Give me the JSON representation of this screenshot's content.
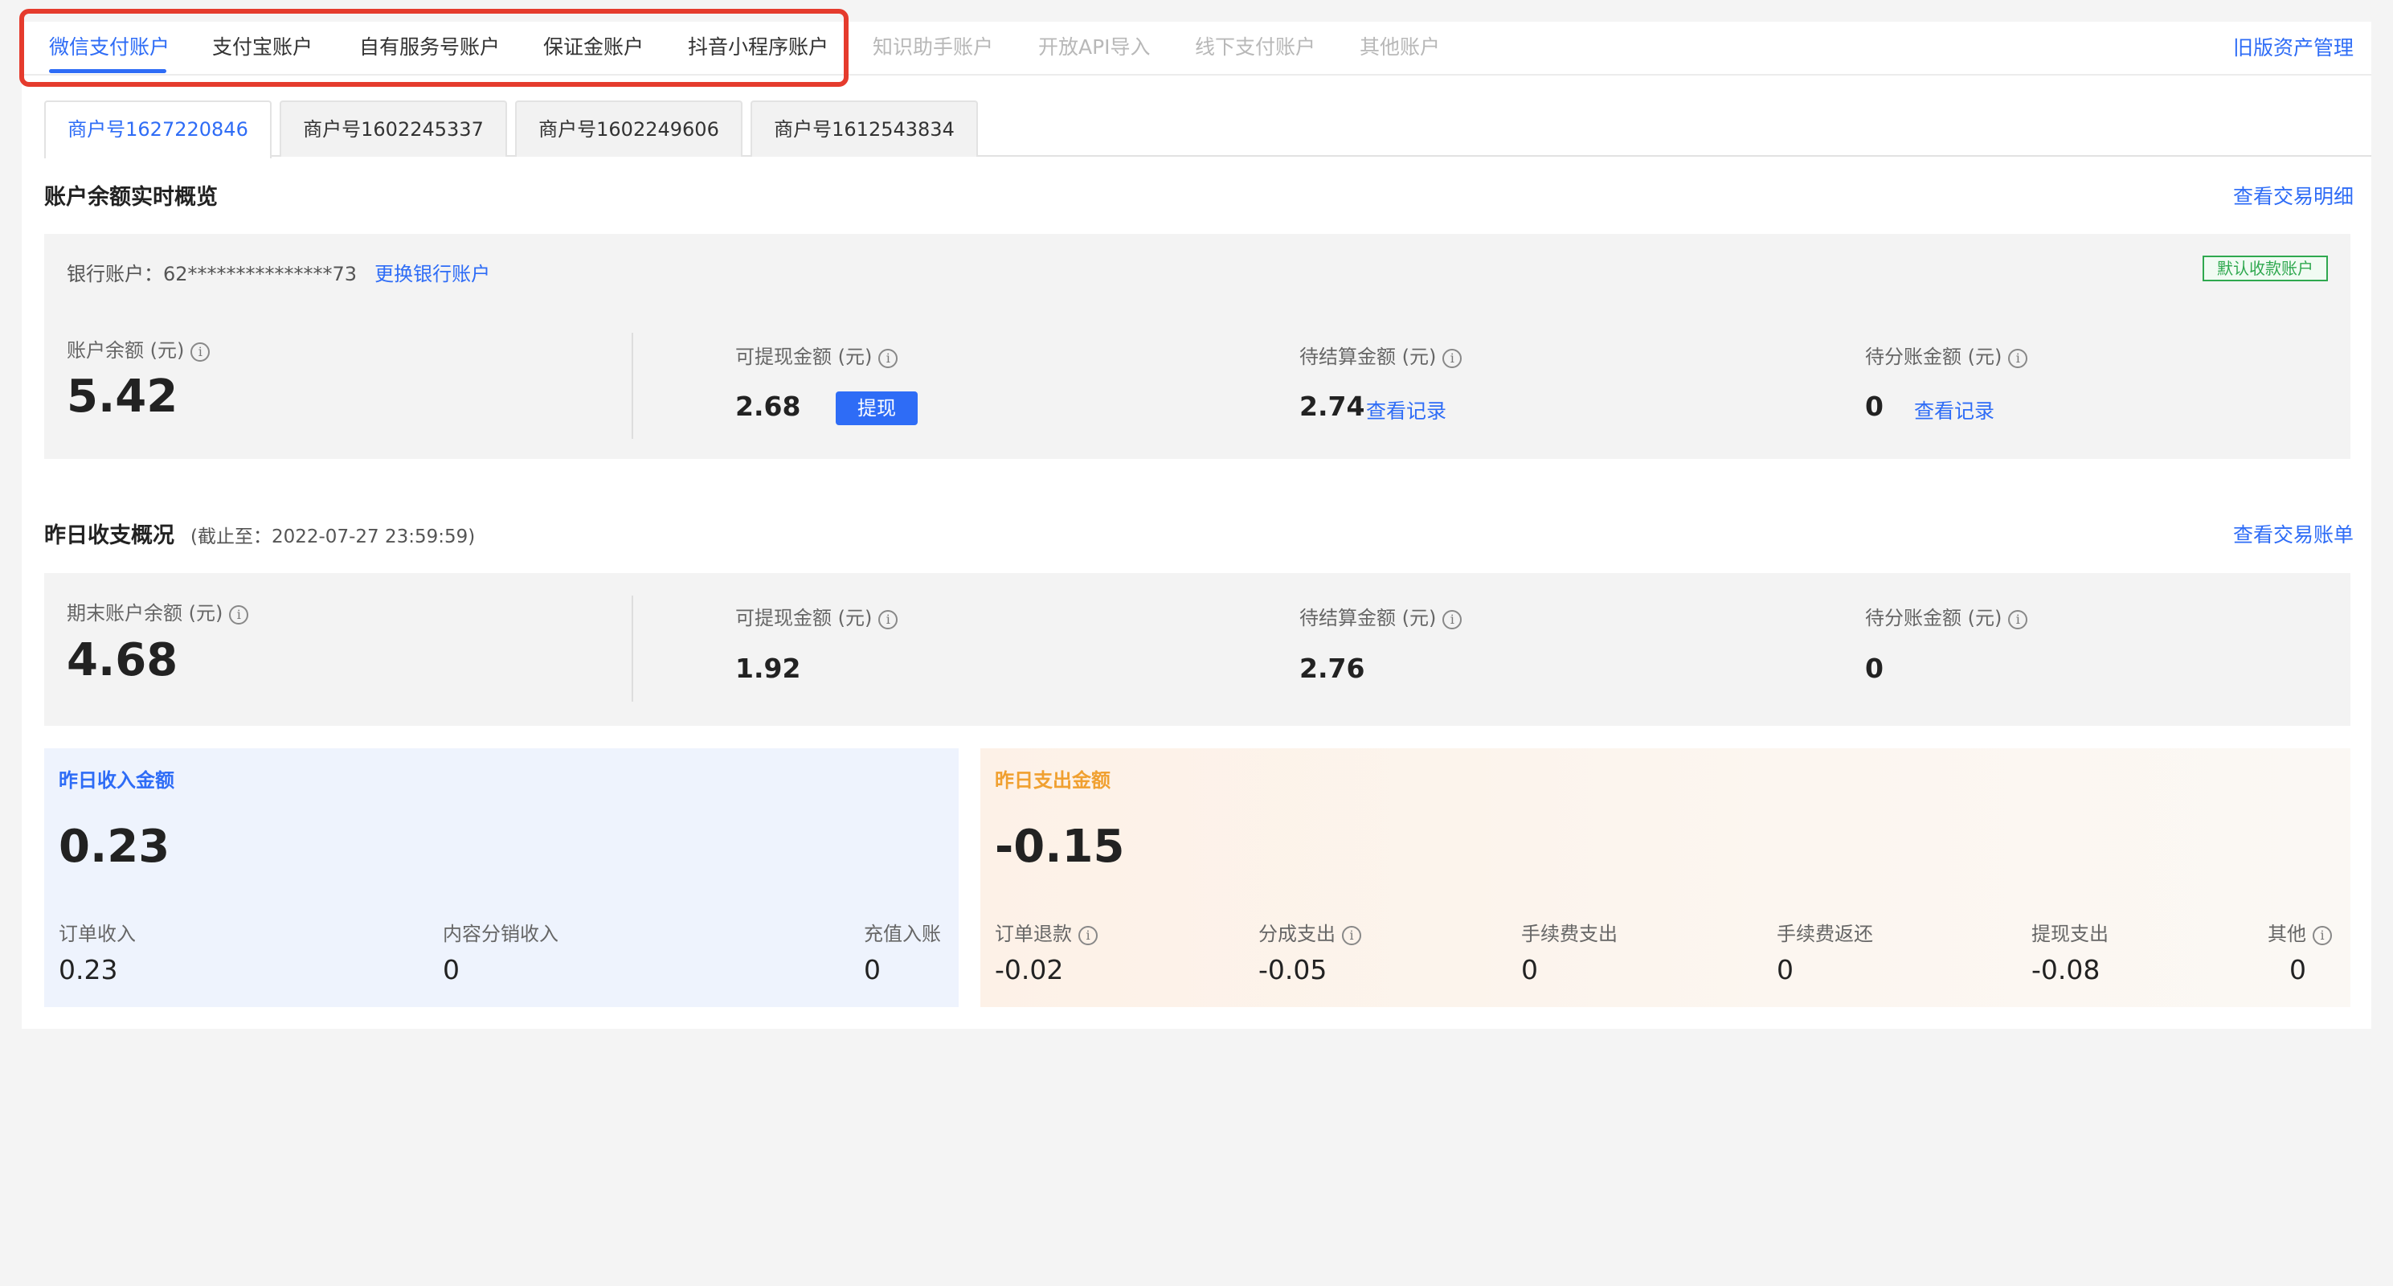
{
  "tabs": {
    "items": [
      {
        "label": "微信支付账户",
        "state": "active"
      },
      {
        "label": "支付宝账户",
        "state": "normal"
      },
      {
        "label": "自有服务号账户",
        "state": "normal"
      },
      {
        "label": "保证金账户",
        "state": "normal"
      },
      {
        "label": "抖音小程序账户",
        "state": "normal"
      },
      {
        "label": "知识助手账户",
        "state": "disabled"
      },
      {
        "label": "开放API导入",
        "state": "disabled"
      },
      {
        "label": "线下支付账户",
        "state": "disabled"
      },
      {
        "label": "其他账户",
        "state": "disabled"
      }
    ],
    "right_link": "旧版资产管理"
  },
  "merchant_tabs": [
    "商户号1627220846",
    "商户号1602245337",
    "商户号1602249606",
    "商户号1612543834"
  ],
  "balance_overview": {
    "title": "账户余额实时概览",
    "link": "查看交易明细",
    "bank_label": "银行账户：",
    "bank_number": "62***************73",
    "change_bank": "更换银行账户",
    "badge": "默认收款账户",
    "account_balance_label": "账户余额 (元)",
    "account_balance": "5.42",
    "withdrawable_label": "可提现金额 (元)",
    "withdrawable": "2.68",
    "withdraw_button": "提现",
    "pending_settle_label": "待结算金额 (元)",
    "pending_settle": "2.74",
    "pending_settle_link": "查看记录",
    "pending_split_label": "待分账金额 (元)",
    "pending_split": "0",
    "pending_split_link": "查看记录"
  },
  "yesterday": {
    "title": "昨日收支概况",
    "subtitle": "(截止至：2022-07-27 23:59:59)",
    "link": "查看交易账单",
    "end_balance_label": "期末账户余额 (元)",
    "end_balance": "4.68",
    "withdrawable_label": "可提现金额 (元)",
    "withdrawable": "1.92",
    "pending_settle_label": "待结算金额 (元)",
    "pending_settle": "2.76",
    "pending_split_label": "待分账金额 (元)",
    "pending_split": "0"
  },
  "income": {
    "title": "昨日收入金额",
    "total": "0.23",
    "items": [
      {
        "label": "订单收入",
        "value": "0.23"
      },
      {
        "label": "内容分销收入",
        "value": "0"
      },
      {
        "label": "充值入账",
        "value": "0"
      }
    ]
  },
  "expense": {
    "title": "昨日支出金额",
    "total": "-0.15",
    "items": [
      {
        "label": "订单退款",
        "value": "-0.02"
      },
      {
        "label": "分成支出",
        "value": "-0.05"
      },
      {
        "label": "手续费支出",
        "value": "0"
      },
      {
        "label": "手续费返还",
        "value": "0"
      },
      {
        "label": "提现支出",
        "value": "-0.08"
      },
      {
        "label": "其他",
        "value": "0"
      }
    ]
  },
  "colors": {
    "accent": "#2e6cf6",
    "income_title": "#2e6cf6",
    "expense_title": "#f0a030",
    "highlight": "#e53b2d",
    "badge": "#2fa84f"
  },
  "icons": {
    "info": "info-circle-icon"
  }
}
